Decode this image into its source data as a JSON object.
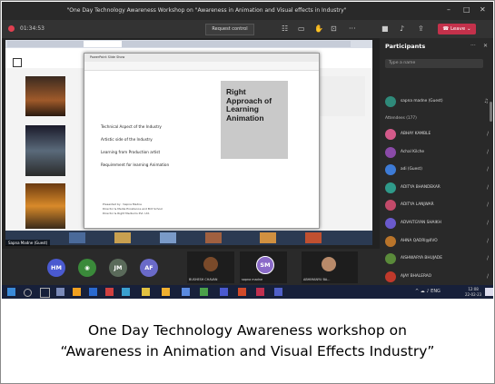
{
  "window": {
    "title": "\"One Day Technology Awareness Workshop on \"Awareness in Animation and Visual effects in Industry\""
  },
  "meeting": {
    "timer": "01:34:53",
    "request_control_label": "Request control",
    "leave_label": "Leave"
  },
  "slide": {
    "window_title": "PowerPoint Slide Show",
    "bullets": [
      "Technical Aspect of the Industry",
      "Artistic side of the Industry",
      "Learning from Production artist",
      "Requirement for learning Animation"
    ],
    "heading_lines": [
      "Right",
      "Approach of",
      "Learning",
      "Animation"
    ],
    "footer_lines": [
      "Presented by : Sapna Madne",
      "Director & Media Excellence and Brit School",
      "Director & Right Mediums Pvt. Ltd."
    ]
  },
  "presenter_label": "Sapna Madne (Guest)",
  "participants": {
    "header": "Participants",
    "search_placeholder": "Type a name",
    "presenter": "sapna madne (Guest)",
    "section_label": "Attendees (177)",
    "list": [
      {
        "name": "ABHAY KAMBLE",
        "color": "#d35a8a"
      },
      {
        "name": "Achal Kilche",
        "color": "#8a4aa8"
      },
      {
        "name": "adi (Guest)",
        "color": "#3d7bd6"
      },
      {
        "name": "ADITYA BHANDEKAR",
        "color": "#2f9a8a"
      },
      {
        "name": "ADITYA LANJWAR",
        "color": "#c24a6a"
      },
      {
        "name": "ADVAITGYAN SHAIKH",
        "color": "#6a5acd"
      },
      {
        "name": "AHNA QADRI@IIVO",
        "color": "#b9742a"
      },
      {
        "name": "AISHWARYA BHUJADE",
        "color": "#5a8a3a"
      },
      {
        "name": "AJAY BHALERAO",
        "color": "#c0392b"
      }
    ]
  },
  "gallery": {
    "initials": [
      "HM",
      "JM",
      "AF",
      "SM"
    ],
    "tiles": [
      "BUSHESH CHAVAN",
      "sapna madne",
      "ABHIMANYU BA..."
    ]
  },
  "taskbar": {
    "lang": "ENG",
    "time": "12:08",
    "date": "22-02-23"
  },
  "caption": {
    "line1": "One Day Technology Awareness workshop on",
    "line2": "“Awareness in Animation and Visual Effects Industry”"
  }
}
